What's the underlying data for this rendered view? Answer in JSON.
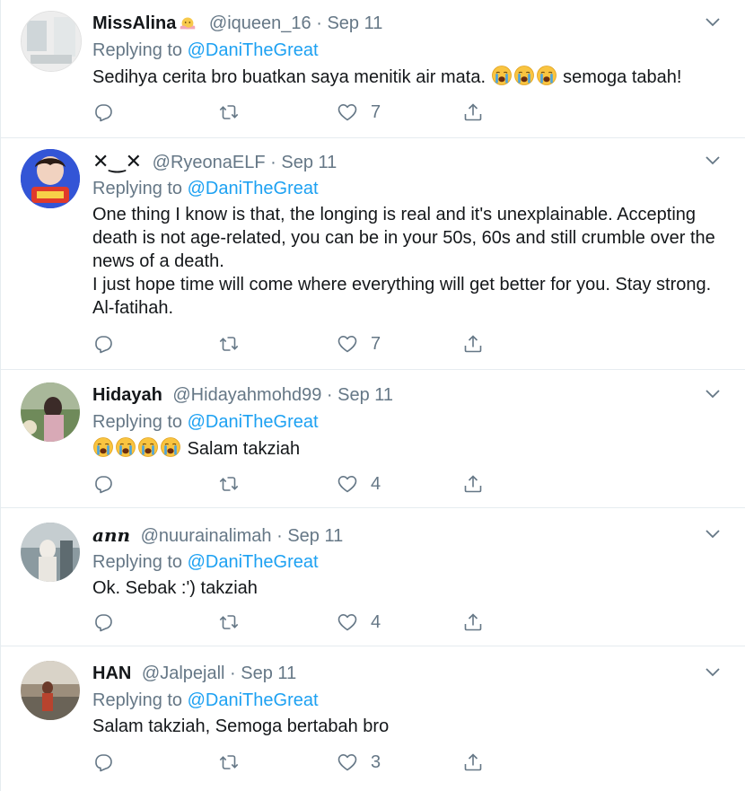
{
  "tweets": [
    {
      "name": "MissAlina",
      "handle": "@iqueen_16",
      "date": "Sep 11",
      "reply_label": "Replying to",
      "reply_to": "@DaniTheGreat",
      "text_before": "Sedihya cerita bro buatkan saya menitik air mata.",
      "emoji_count": 3,
      "text_after": "semoga tabah!",
      "likes": "7"
    },
    {
      "name": "✕‿✕",
      "handle": "@RyeonaELF",
      "date": "Sep 11",
      "reply_label": "Replying to",
      "reply_to": "@DaniTheGreat",
      "text": "One thing I know is that, the longing is real and it's unexplainable. Accepting death is not age-related, you can be in your 50s, 60s and still crumble over the news of a death.\nI just hope time will come where everything will get better for you. Stay strong. Al-fatihah.",
      "likes": "7"
    },
    {
      "name": "Hidayah",
      "handle": "@Hidayahmohd99",
      "date": "Sep 11",
      "reply_label": "Replying to",
      "reply_to": "@DaniTheGreat",
      "emoji_count": 4,
      "text_after": "Salam takziah",
      "likes": "4"
    },
    {
      "name": "ann",
      "handle": "@nuurainalimah",
      "date": "Sep 11",
      "reply_label": "Replying to",
      "reply_to": "@DaniTheGreat",
      "text": "Ok. Sebak :') takziah",
      "likes": "4"
    },
    {
      "name": "HAN",
      "handle": "@Jalpejall",
      "date": "Sep 11",
      "reply_label": "Replying to",
      "reply_to": "@DaniTheGreat",
      "text": "Salam takziah, Semoga bertabah bro",
      "likes": "3"
    }
  ],
  "separator": "·",
  "icons": {
    "reply": "reply-icon",
    "retweet": "retweet-icon",
    "like": "heart-icon",
    "share": "share-icon",
    "caret": "chevron-down-icon",
    "emoji": "crying-face-emoji",
    "badge": "sun-emoji"
  },
  "colors": {
    "mention": "#1da1f2",
    "muted": "#657786",
    "text": "#14171a",
    "divider": "#e6ecf0"
  }
}
